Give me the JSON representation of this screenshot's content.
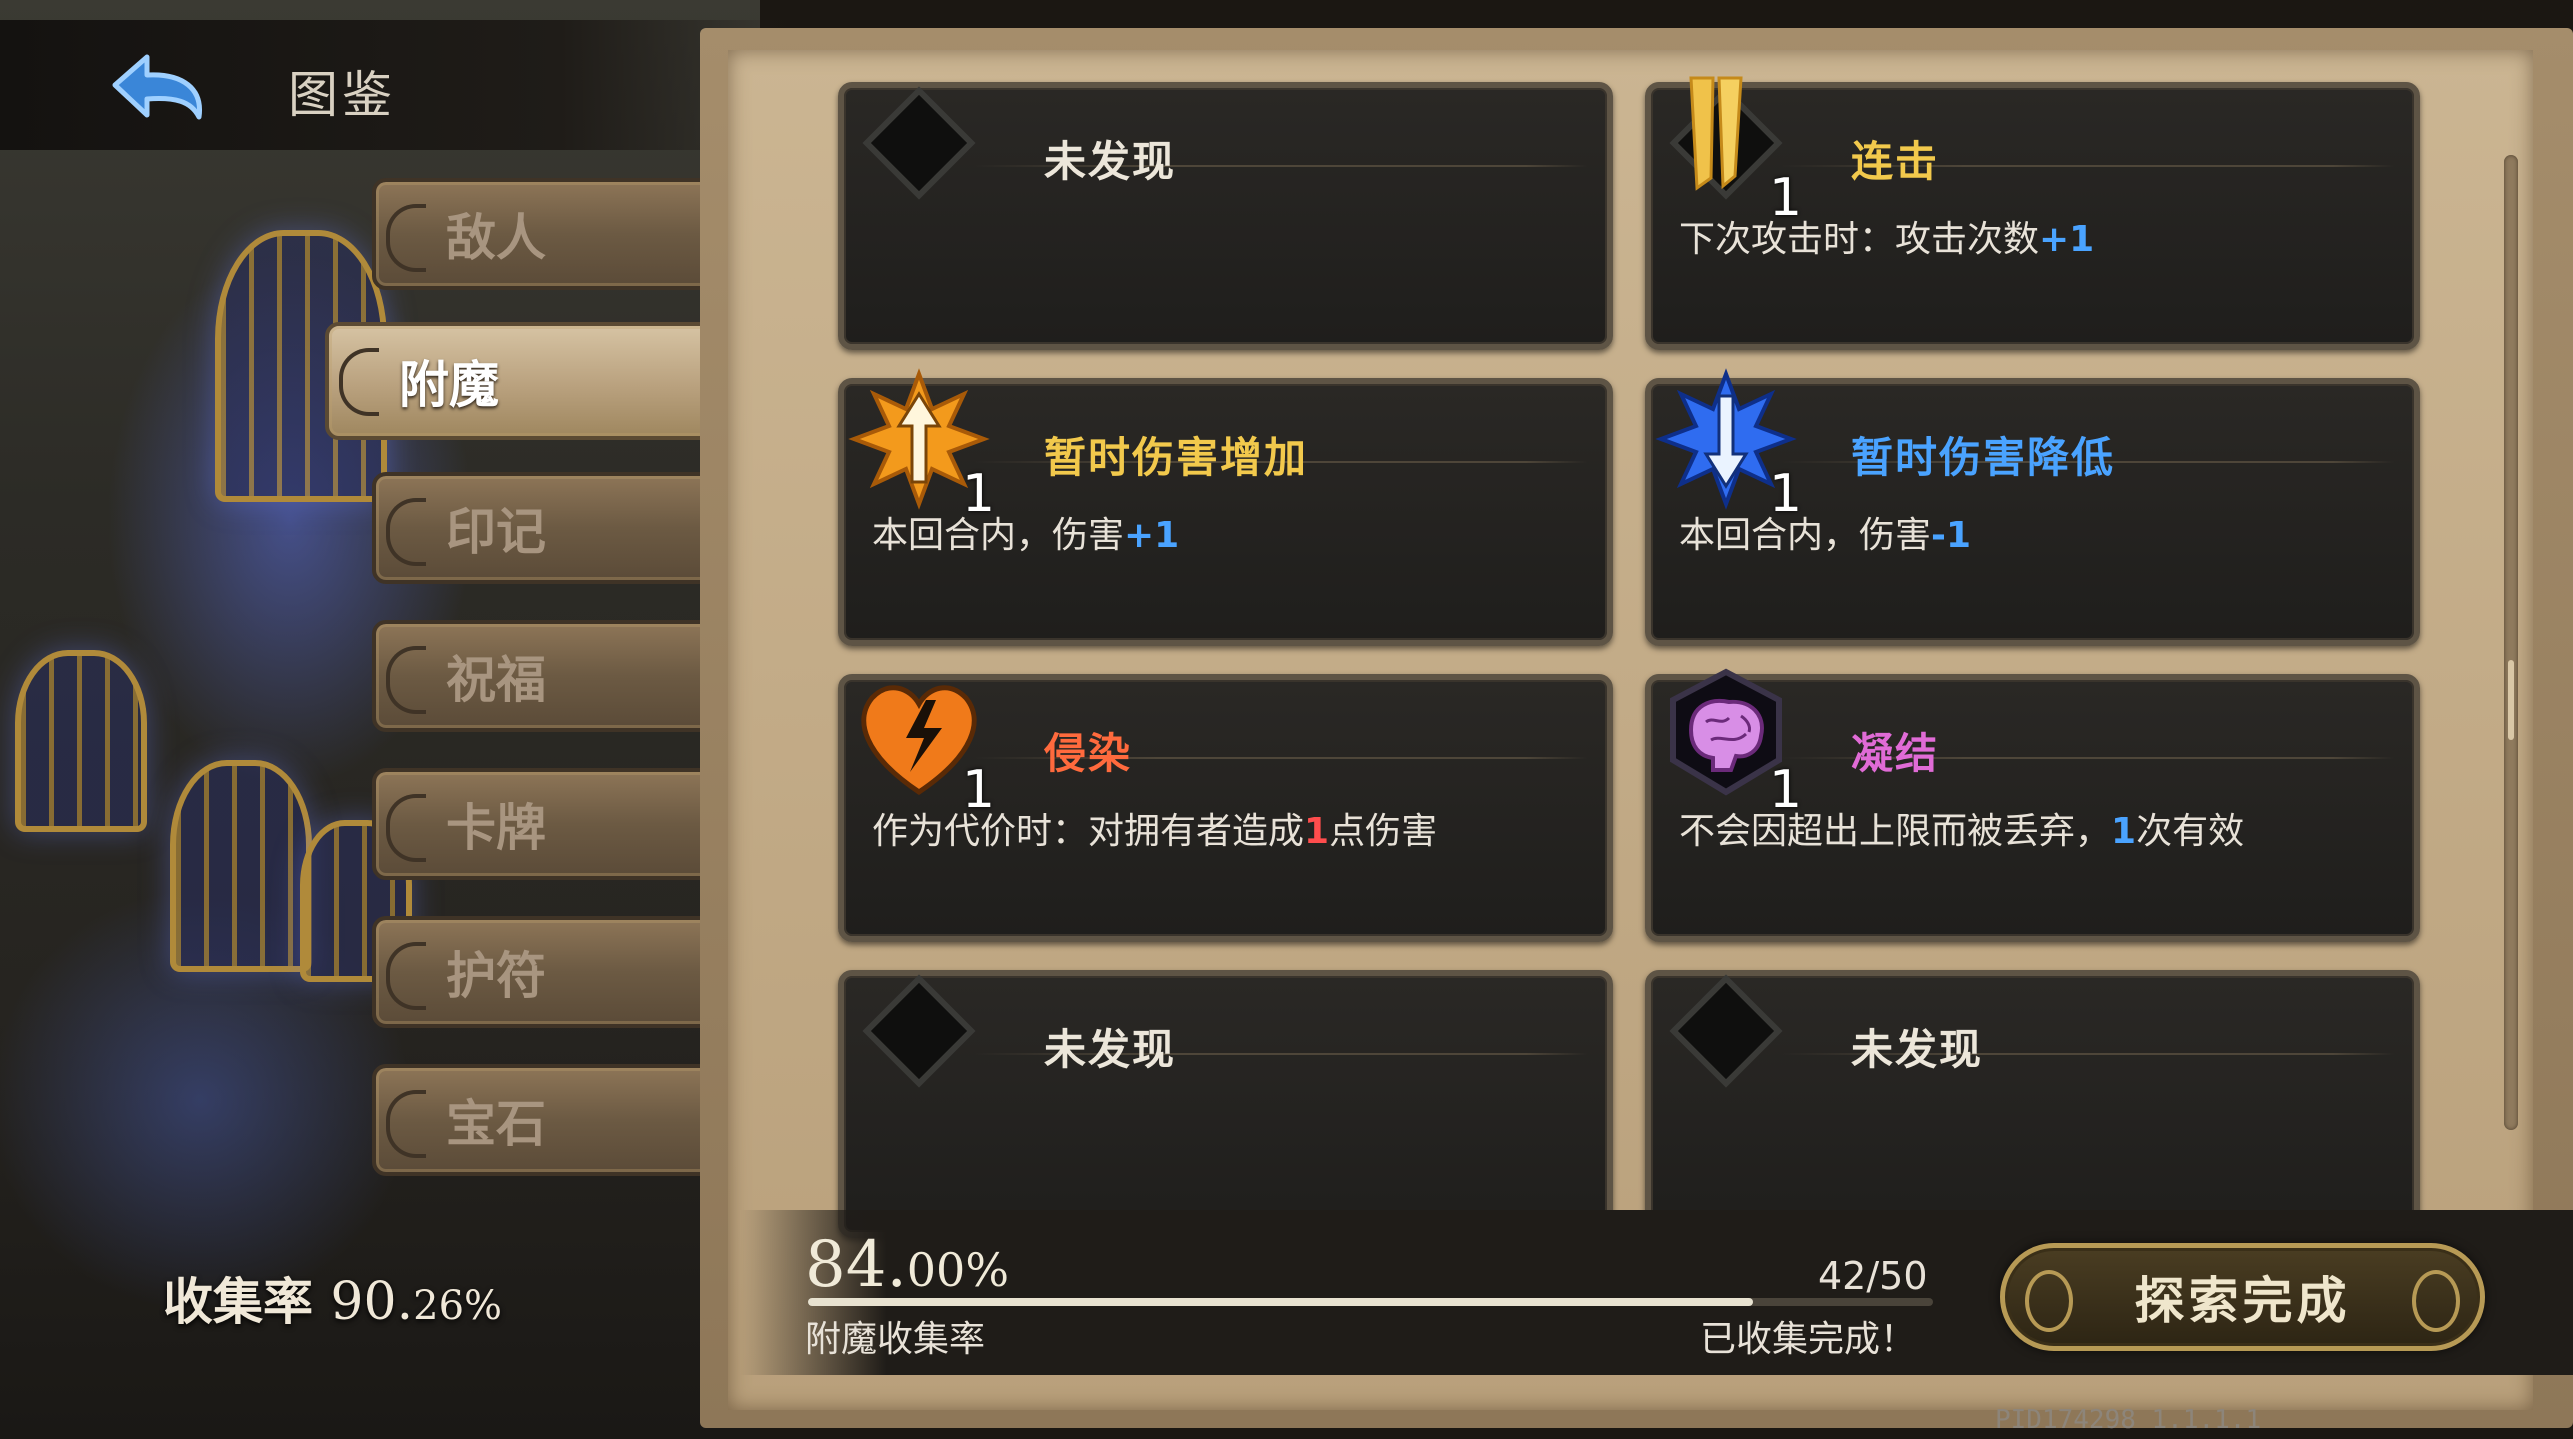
{
  "header": {
    "title": "图鉴"
  },
  "sidebar": {
    "tabs": [
      {
        "label": "敌人",
        "active": false
      },
      {
        "label": "附魔",
        "active": true
      },
      {
        "label": "印记",
        "active": false
      },
      {
        "label": "祝福",
        "active": false
      },
      {
        "label": "卡牌",
        "active": false
      },
      {
        "label": "护符",
        "active": false
      },
      {
        "label": "宝石",
        "active": false
      }
    ],
    "collection": {
      "label": "收集率",
      "value": "90.",
      "value_small": "26%"
    }
  },
  "cards": [
    {
      "title": "未发现",
      "discovered": false
    },
    {
      "title": "连击",
      "count": "1",
      "icon": "swords-icon",
      "title_color": "#f2c94c",
      "desc_pre": "下次攻击时：攻击次数",
      "desc_num": "+1",
      "desc_post": "",
      "num_color": "#4aa3ff"
    },
    {
      "title": "暂时伤害增加",
      "count": "1",
      "icon": "damage-up-icon",
      "title_color": "#f2c94c",
      "desc_pre": "本回合内，伤害",
      "desc_num": "+1",
      "desc_post": "",
      "num_color": "#4aa3ff"
    },
    {
      "title": "暂时伤害降低",
      "count": "1",
      "icon": "damage-down-icon",
      "title_color": "#4aa3ff",
      "desc_pre": "本回合内，伤害",
      "desc_num": "-1",
      "desc_post": "",
      "num_color": "#4aa3ff"
    },
    {
      "title": "侵染",
      "count": "1",
      "icon": "broken-heart-icon",
      "title_color": "#ff6a3d",
      "desc_pre": "作为代价时：对拥有者造成",
      "desc_num": "1",
      "desc_post": "点伤害",
      "num_color": "#ff4d4d"
    },
    {
      "title": "凝结",
      "count": "1",
      "icon": "brain-icon",
      "title_color": "#e06bd6",
      "desc_pre": "不会因超出上限而被丢弃，",
      "desc_num": "1",
      "desc_post": "次有效",
      "num_color": "#4aa3ff"
    },
    {
      "title": "未发现",
      "discovered": false
    },
    {
      "title": "未发现",
      "discovered": false
    }
  ],
  "progress": {
    "percent_main": "84.",
    "percent_small": "00%",
    "fraction": 0.84,
    "count": "42/50",
    "label": "附魔收集率",
    "status": "已收集完成！"
  },
  "finish_button": {
    "label": "探索完成"
  },
  "version": "PID174298  1.1.1.1",
  "colors": {
    "gold": "#b79a55",
    "parchment": "#cbb592",
    "card_bg": "#1f1e1c"
  }
}
